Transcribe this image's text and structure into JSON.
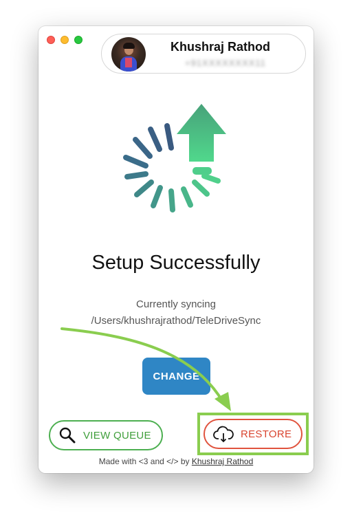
{
  "profile": {
    "name": "Khushraj Rathod",
    "phone": "+91XXXXXXXX11"
  },
  "main": {
    "title": "Setup Successfully",
    "sync_label": "Currently syncing",
    "sync_path": "/Users/khushrajrathod/TeleDriveSync",
    "change_label": "CHANGE"
  },
  "actions": {
    "view_queue_label": "VIEW QUEUE",
    "restore_label": "RESTORE"
  },
  "footer": {
    "prefix": "Made with <3 and </> by",
    "author": "Khushraj Rathod"
  },
  "icons": {
    "sync": "upload-sync-icon",
    "search": "magnifier-icon",
    "restore": "cloud-download-icon"
  },
  "colors": {
    "change_button": "#2f86c5",
    "view_queue": "#4caf50",
    "restore": "#e0533d",
    "highlight": "#8acd4f",
    "sync_gradient_start": "#3b6d8c",
    "sync_gradient_end": "#4fd28a"
  }
}
